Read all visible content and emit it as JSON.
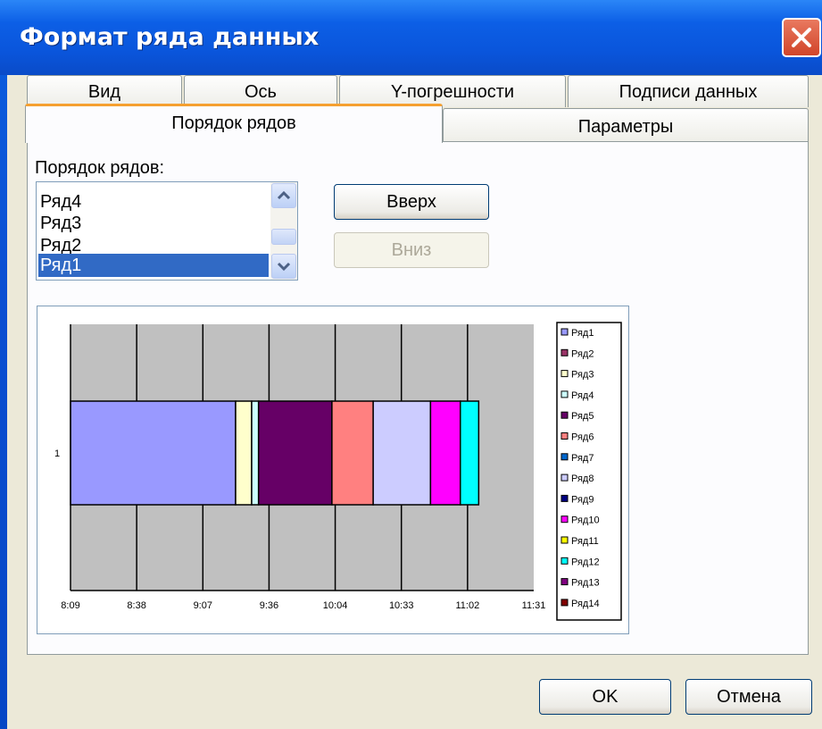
{
  "window": {
    "title": "Формат ряда данных"
  },
  "tabs_row1": [
    "Вид",
    "Ось",
    "Y-погрешности",
    "Подписи данных"
  ],
  "tabs_row2": [
    "Порядок рядов",
    "Параметры"
  ],
  "series_order": {
    "label": "Порядок рядов:",
    "items": [
      "Ряд4",
      "Ряд3",
      "Ряд2",
      "Ряд1"
    ],
    "selected": "Ряд1"
  },
  "buttons": {
    "up": "Вверх",
    "down": "Вниз",
    "ok": "OK",
    "cancel": "Отмена"
  },
  "chart_data": {
    "type": "bar",
    "orientation": "horizontal",
    "stacked": true,
    "categories": [
      "1"
    ],
    "x_ticks": [
      "8:09",
      "8:38",
      "9:07",
      "9:36",
      "10:04",
      "10:33",
      "11:02",
      "11:31"
    ],
    "xlim": [
      "8:09",
      "11:31"
    ],
    "grid": true,
    "legend_position": "right",
    "legend": [
      "Ряд1",
      "Ряд2",
      "Ряд3",
      "Ряд4",
      "Ряд5",
      "Ряд6",
      "Ряд7",
      "Ряд8",
      "Ряд9",
      "Ряд10",
      "Ряд11",
      "Ряд12",
      "Ряд13",
      "Ряд14"
    ],
    "legend_colors": [
      "#9999ff",
      "#993366",
      "#ffffcc",
      "#ccffff",
      "#660066",
      "#ff8080",
      "#0066cc",
      "#ccccff",
      "#000080",
      "#ff00ff",
      "#ffff00",
      "#00ffff",
      "#800080",
      "#800000"
    ],
    "segments": [
      {
        "series": "Ряд1",
        "start": "8:09",
        "end": "9:21",
        "color": "#9999ff"
      },
      {
        "series": "Ряд3",
        "start": "9:21",
        "end": "9:28",
        "color": "#ffffcc"
      },
      {
        "series": "Ряд4",
        "start": "9:28",
        "end": "9:31",
        "color": "#ccffff"
      },
      {
        "series": "Ряд5",
        "start": "9:31",
        "end": "10:03",
        "color": "#660066"
      },
      {
        "series": "Ряд6",
        "start": "10:03",
        "end": "10:21",
        "color": "#ff8080"
      },
      {
        "series": "Ряд8",
        "start": "10:21",
        "end": "10:46",
        "color": "#ccccff"
      },
      {
        "series": "Ряд10",
        "start": "10:46",
        "end": "10:59",
        "color": "#ff00ff"
      },
      {
        "series": "Ряд12",
        "start": "10:59",
        "end": "11:07",
        "color": "#00ffff"
      }
    ]
  }
}
